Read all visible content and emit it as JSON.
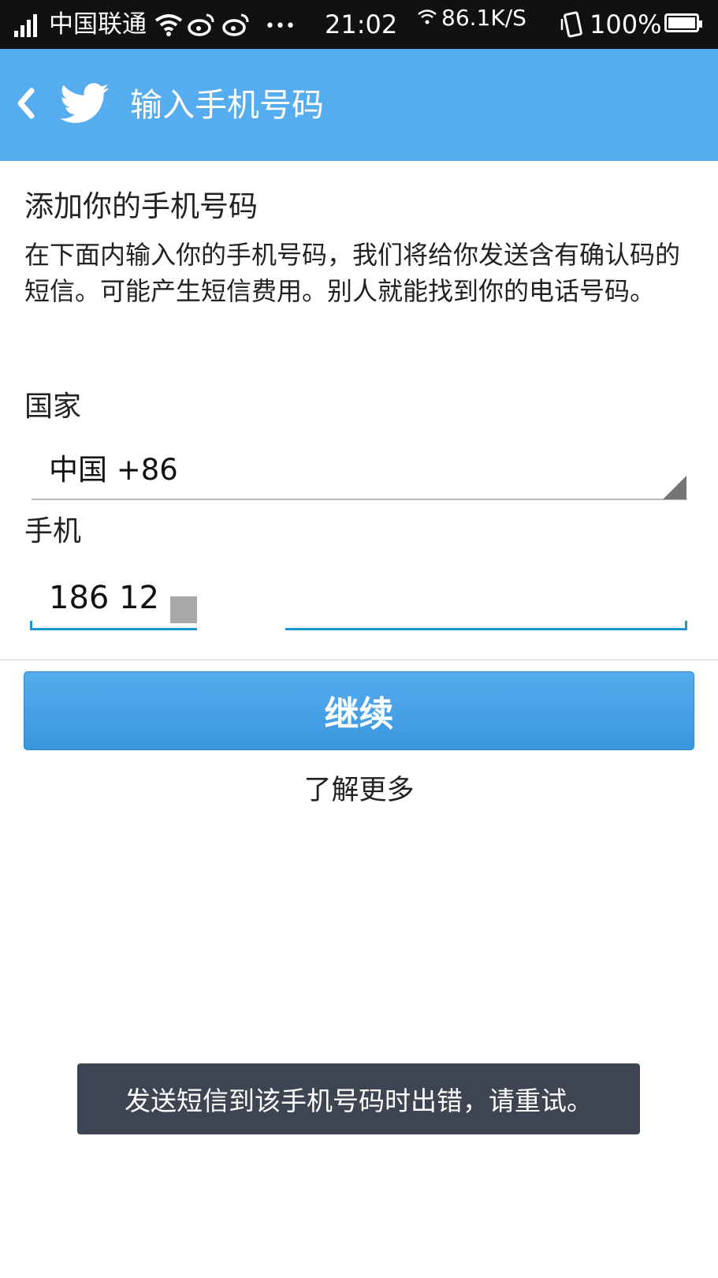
{
  "status_bar": {
    "carrier": "中国联通",
    "more": "•••",
    "time": "21:02",
    "speed": "86.1K/S",
    "battery": "100%"
  },
  "app_bar": {
    "title": "输入手机号码",
    "color": "#55acee"
  },
  "content": {
    "heading": "添加你的手机号码",
    "description": "在下面内输入你的手机号码，我们将给你发送含有确认码的短信。可能产生短信费用。别人就能找到你的电话号码。",
    "country_label": "国家",
    "country_value": "中国 +86",
    "phone_label": "手机",
    "phone_value": "186 12"
  },
  "actions": {
    "continue_label": "继续",
    "learn_more": "了解更多"
  },
  "toast": {
    "message": "发送短信到该手机号码时出错，请重试。"
  }
}
